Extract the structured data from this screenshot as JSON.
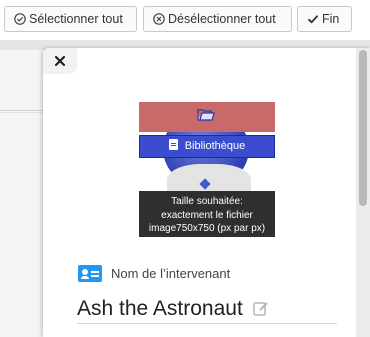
{
  "toolbar": {
    "select_all_label": "Sélectionner tout",
    "deselect_all_label": "Désélectionner tout",
    "finish_label": "Fin"
  },
  "modal": {
    "close_icon": "close-icon",
    "avatar": {
      "library_button_label": "Bibliothèque",
      "upload_icon": "folder-icon",
      "tooltip_lines": [
        "Taille souhaitée:",
        "exactement le fichier",
        "image750x750 (px par px)"
      ]
    },
    "intervenant": {
      "label": "Nom de l’intervenant",
      "value": "Ash the Astronaut",
      "icon": "contact-card-icon",
      "edit_icon": "edit-icon"
    }
  },
  "colors": {
    "accent_blue": "#3b4ccf",
    "card_icon": "#2196f3",
    "tooltip_bg": "#2f2f2f",
    "band_red": "#c96a6a"
  }
}
